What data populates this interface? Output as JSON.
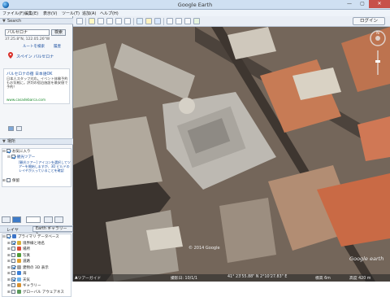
{
  "window": {
    "title": "Google Earth",
    "minimize": "—",
    "maximize": "▢",
    "close": "✕"
  },
  "menu": [
    "ファイル(F)",
    "編集(E)",
    "表示(V)",
    "ツール(T)",
    "追加(A)",
    "ヘルプ(H)"
  ],
  "toolbar": {
    "login_label": "ログイン",
    "icons": [
      "sidebar-icon",
      "placemark-icon",
      "polygon-icon",
      "path-icon",
      "overlay-icon",
      "tour-icon",
      "history-icon",
      "sun-icon",
      "planet-icon",
      "ruler-icon",
      "email-icon",
      "print-icon",
      "map-icon"
    ]
  },
  "search": {
    "header": "Search",
    "query": "バルセロナ",
    "button": "検索",
    "coords": "37.25.8°N, 122.05.26°W",
    "route_link": "ルートを検索",
    "history_link": "履歴",
    "result_title": "スペイン バルセロナ",
    "ad": {
      "title": "バルセロナの宿 日本語OK",
      "text": "日本人スタッフ対応。イベント体験予約もお気軽に。評判の宿泊施設を最安値で予約！",
      "url": "www.casadebarca.com"
    }
  },
  "places": {
    "header": "場所",
    "items": [
      {
        "label": "お気に入り",
        "checked": true
      },
      {
        "label": "観光ツアー",
        "checked": true
      },
      {
        "label": "[観光ツアー] アイコンを選択してツアーを開始しますが、3D ビルドのレイヤが入っていることを確認",
        "checked": false
      },
      {
        "label": "保留",
        "checked": false
      }
    ]
  },
  "layers": {
    "tab_layers": "レイヤ",
    "tab_gallery": "Earth ギャラリー »",
    "items": [
      {
        "label": "プライマリ データベース",
        "checked": true,
        "color": "#3b73c8"
      },
      {
        "label": "境界線と地名",
        "checked": true,
        "color": "#d8b03a"
      },
      {
        "label": "場所",
        "checked": false,
        "color": "#d84b3a"
      },
      {
        "label": "写真",
        "checked": false,
        "color": "#4e9a3a"
      },
      {
        "label": "道路",
        "checked": false,
        "color": "#e0a030"
      },
      {
        "label": "建物の 3D 表示",
        "checked": true,
        "color": "#a0a0a0"
      },
      {
        "label": "海",
        "checked": false,
        "color": "#3a7fd8"
      },
      {
        "label": "天気",
        "checked": true,
        "color": "#6fb3e8"
      },
      {
        "label": "ギャラリー",
        "checked": false,
        "color": "#d89030"
      },
      {
        "label": "グローバル アウェアネス",
        "checked": false,
        "color": "#5a9a5a"
      }
    ]
  },
  "status": {
    "tour_guide": "ツアーガイド",
    "imagery_date": "撮影日: 10/1/1",
    "coordinates": "41°  23'55.88\" N    2°10'27.83\" E",
    "elevation": "標高  6m",
    "eye_alt": "高度  420 m"
  },
  "map": {
    "attribution": "© 2014 Google",
    "logo": "Google earth"
  }
}
